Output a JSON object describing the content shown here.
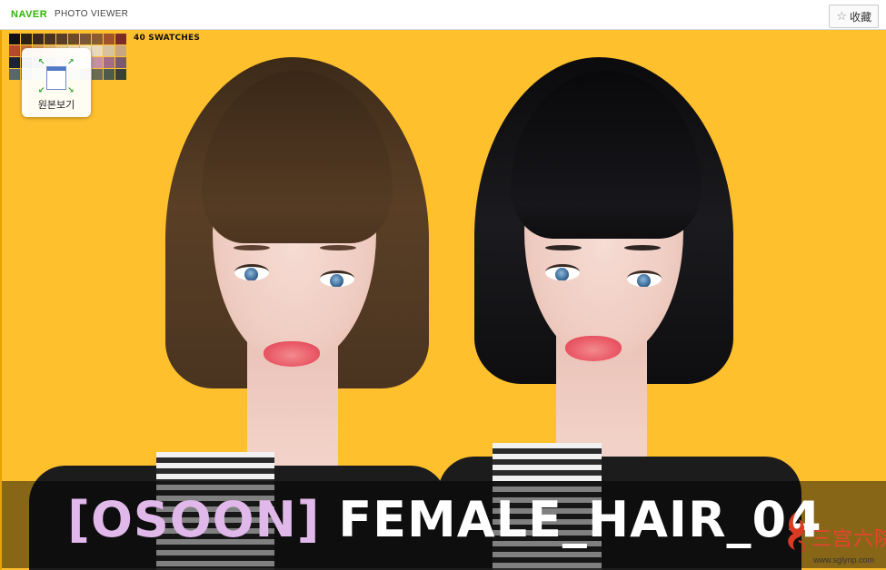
{
  "header": {
    "brand": "NAVER",
    "title": "PHOTO VIEWER",
    "favorite_label": "收藏",
    "favorite_icon": "star-icon"
  },
  "toolbar": {
    "swatch_label": "40 SWATCHES",
    "original_view_label": "원본보기"
  },
  "swatches": [
    "#111111",
    "#2b2117",
    "#3b2a1c",
    "#4a3322",
    "#5a3d27",
    "#6b4a2d",
    "#7c5635",
    "#8a5c2f",
    "#a1542b",
    "#7a2c22",
    "#b54a2a",
    "#c8703a",
    "#d69a55",
    "#e1b774",
    "#e9cf98",
    "#f0ddb6",
    "#f4e6c8",
    "#ead9b9",
    "#d8c3a0",
    "#c9a77c",
    "#1c2433",
    "#2e3e5c",
    "#5a6478",
    "#8b8f98",
    "#b4b2b0",
    "#d2cfcc",
    "#e6e3e0",
    "#c78fa2",
    "#a26d85",
    "#7c5a6e",
    "#5b6670",
    "#7d8891",
    "#9aa3a8",
    "#c0c3c2",
    "#d7d9d3",
    "#b9b59c",
    "#8d8a6c",
    "#6c6b54",
    "#4d5a4c",
    "#394034"
  ],
  "caption": {
    "tag": "[OSOON]",
    "name": " FEMALE_HAIR_04"
  },
  "watermark": {
    "text": "三宫六院",
    "url": "www.sglynp.com"
  },
  "colors": {
    "background": "#ffc02e",
    "brand_green": "#2db400",
    "hair_brown": "#4a3420",
    "hair_black": "#0e0e10",
    "caption_tag": "#e0b8ea"
  }
}
